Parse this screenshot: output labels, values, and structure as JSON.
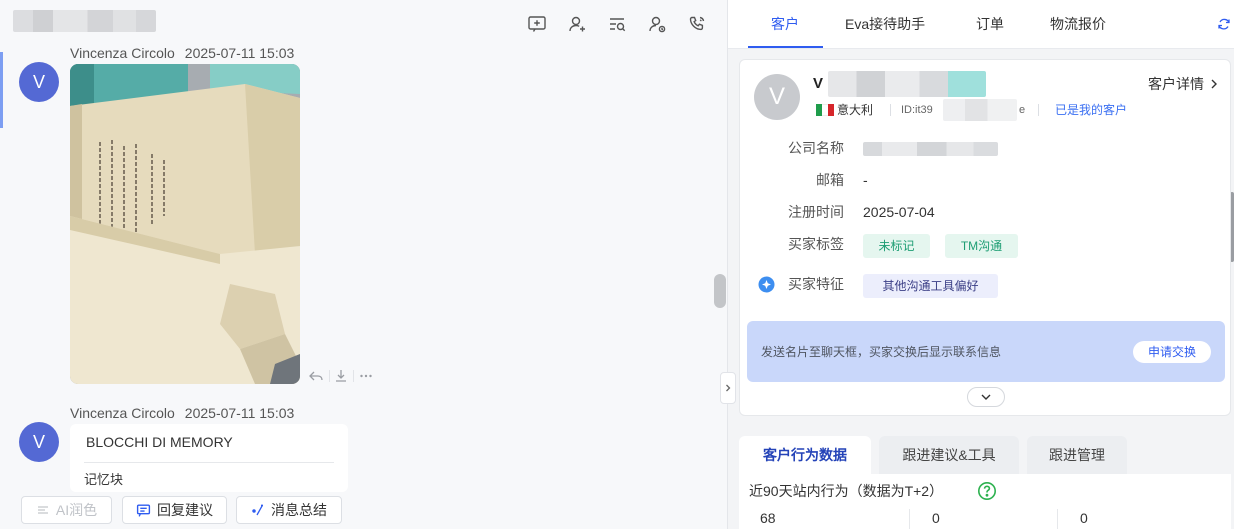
{
  "colors": {
    "accent": "#2f5cf0",
    "chat_avatar": "#5469d4",
    "customer_avatar": "#c8cace",
    "tag_green_bg": "#e5f6ef",
    "tag_green_text": "#1e9e74",
    "tag_purple_bg": "#eceefc",
    "tag_purple_text": "#3b3f86",
    "info_box_bg": "#c9d7fa",
    "help_green": "#2db14f"
  },
  "chat": {
    "header_icons": [
      "add-quick-reply-icon",
      "add-contact-icon",
      "search-messages-icon",
      "customer-assign-icon",
      "phone-call-icon"
    ],
    "message_actions": [
      "reply-icon",
      "download-icon",
      "more-icon"
    ],
    "messages": [
      {
        "sender": "Vincenza Circolo",
        "time": "2025-07-11 15:03",
        "avatar": "V"
      },
      {
        "sender": "Vincenza Circolo",
        "time": "2025-07-11 15:03",
        "avatar": "V",
        "lines": [
          "BLOCCHI DI MEMORY",
          "记忆块"
        ]
      }
    ],
    "toolbar": {
      "ai_polish": "AI润色",
      "reply_suggestions": "回复建议",
      "message_summary": "消息总结"
    }
  },
  "panel": {
    "tabs": [
      {
        "label": "客户",
        "active": true
      },
      {
        "label": "Eva接待助手",
        "active": false
      },
      {
        "label": "订单",
        "active": false
      },
      {
        "label": "物流报价",
        "active": false
      }
    ],
    "customer": {
      "avatar_letter": "V",
      "name_visible": "V",
      "detail_link": "客户详情",
      "country": "意大利",
      "id_prefix": "ID:it39",
      "id_suffix": "e",
      "relationship": "已是我的客户",
      "fields": {
        "company": {
          "label": "公司名称"
        },
        "email": {
          "label": "邮箱",
          "value": "-"
        },
        "registered": {
          "label": "注册时间",
          "value": "2025-07-04"
        },
        "tags": {
          "label": "买家标签",
          "items": [
            "未标记",
            "TM沟通"
          ]
        },
        "traits": {
          "label": "买家特征",
          "items": [
            "其他沟通工具偏好"
          ]
        }
      },
      "exchange": {
        "text": "发送名片至聊天框，买家交换后显示联系信息",
        "button": "申请交换"
      }
    },
    "sub_tabs": [
      {
        "label": "客户行为数据",
        "active": true
      },
      {
        "label": "跟进建议&工具",
        "active": false
      },
      {
        "label": "跟进管理",
        "active": false
      }
    ],
    "behavior": {
      "title": "近90天站内行为（数据为T+2）",
      "values": [
        68,
        0,
        0
      ]
    }
  }
}
